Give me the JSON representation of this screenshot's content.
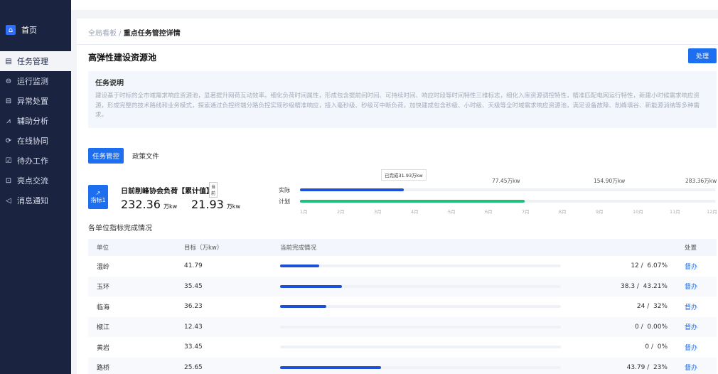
{
  "sidebar": {
    "home": "首页",
    "items": [
      {
        "label": "任务管理",
        "icon": "list-icon",
        "glyph": "▤",
        "active": true
      },
      {
        "label": "运行监测",
        "icon": "minus-circle-icon",
        "glyph": "⊖",
        "active": false
      },
      {
        "label": "异常处置",
        "icon": "exception-icon",
        "glyph": "⊟",
        "active": false
      },
      {
        "label": "辅助分析",
        "icon": "chart-icon",
        "glyph": "⩘",
        "active": false
      },
      {
        "label": "在线协同",
        "icon": "sync-icon",
        "glyph": "⟳",
        "active": false
      },
      {
        "label": "待办工作",
        "icon": "todo-icon",
        "glyph": "☑",
        "active": false
      },
      {
        "label": "亮点交流",
        "icon": "chat-icon",
        "glyph": "⊡",
        "active": false
      },
      {
        "label": "消息通知",
        "icon": "bell-icon",
        "glyph": "◁",
        "active": false
      }
    ]
  },
  "breadcrumb": {
    "parent": "全局看板",
    "sep": " / ",
    "current": "重点任务管控详情"
  },
  "page": {
    "title": "高弹性建设资源池",
    "handle_button": "处理"
  },
  "description": {
    "title": "任务说明",
    "text": "建设基于时标的全市域需求响应资源池，显著提升网荷互动效率。细化负荷时间属性，形成包含提前间时间、可持续时间、响应时段等时间特性三维标志，细化入库资源调控特性，精准匹配电网运行特性，新建小时候需求响应资源，形成完整的技术路线和业务模式，探索通过负控终端分路负控实现秒级精准响应，接入毫秒级、秒级可中断负荷，加快建成包含秒级、小时级、天级等全时域需求响应资源池，满足设备故障、削峰填谷、新能源消纳等多种需求。"
  },
  "tabs": [
    {
      "label": "任务管控",
      "active": true
    },
    {
      "label": "政策文件",
      "active": false
    }
  ],
  "indicator": {
    "badge": "指标1",
    "name": "日前削峰协会负荷【累计值】",
    "tooltip": "当前",
    "value1": "232.36",
    "unit1": "万kw",
    "value2": "21.93",
    "unit2": "万kw"
  },
  "progress": {
    "actual_label": "实际",
    "plan_label": "计划",
    "completed_tip": "已完成31.93万kw",
    "markers": [
      "77.45万kw",
      "154.90万kw",
      "283.36万kw"
    ],
    "actual_fraction": 0.25,
    "plan_fraction": 0.54,
    "actual_color": "#1e4fd9",
    "plan_color": "#1fbf7a",
    "months": [
      "1月",
      "2月",
      "3月",
      "4月",
      "5月",
      "6月",
      "7月",
      "8月",
      "9月",
      "10月",
      "11月",
      "12月"
    ]
  },
  "table_section": {
    "title": "各单位指标完成情况",
    "headers": [
      "单位",
      "目标（万kw）",
      "当前完成情况",
      "",
      "处置"
    ],
    "rows": [
      {
        "unit": "温岭",
        "target": "41.79",
        "done": "12",
        "pct": "6.07%",
        "fraction": 0.14,
        "action": "督办"
      },
      {
        "unit": "玉环",
        "target": "35.45",
        "done": "38.3",
        "pct": "43.21%",
        "fraction": 0.22,
        "action": "督办"
      },
      {
        "unit": "临海",
        "target": "36.23",
        "done": "24",
        "pct": "32%",
        "fraction": 0.165,
        "action": "督办"
      },
      {
        "unit": "椒江",
        "target": "12.43",
        "done": "0",
        "pct": "0.00%",
        "fraction": 0.0,
        "action": "督办"
      },
      {
        "unit": "黄岩",
        "target": "33.45",
        "done": "0",
        "pct": "0%",
        "fraction": 0.0,
        "action": "督办"
      },
      {
        "unit": "路桥",
        "target": "25.65",
        "done": "43.79",
        "pct": "23%",
        "fraction": 0.36,
        "action": "督办"
      }
    ]
  }
}
